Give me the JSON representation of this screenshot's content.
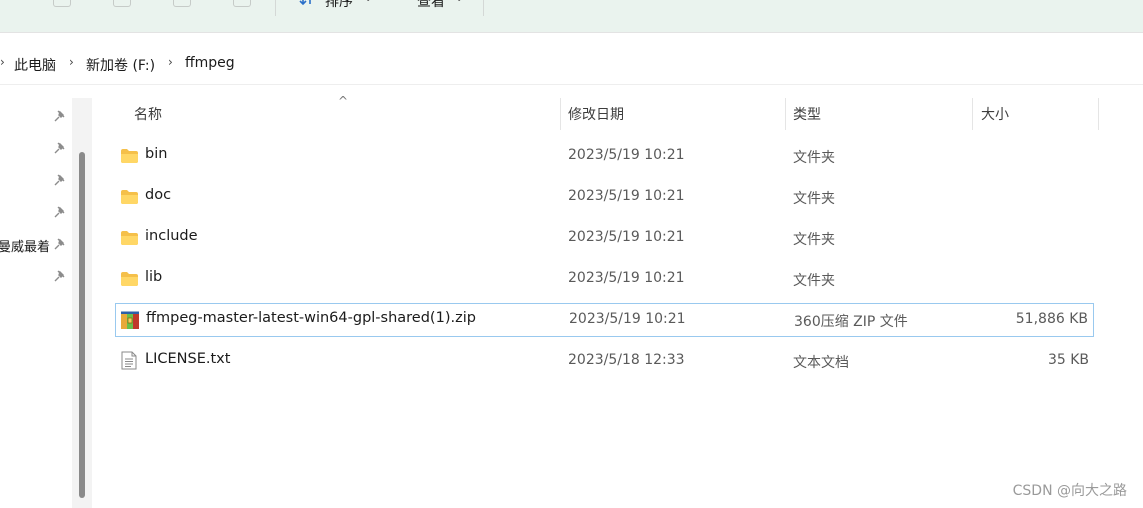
{
  "toolbar": {
    "sort_label": "排序",
    "view_label": "查看",
    "more_label": "···"
  },
  "breadcrumb": {
    "items": [
      "此电脑",
      "新加卷 (F:)",
      "ffmpeg"
    ]
  },
  "nav": {
    "partial_item": "曼威最着"
  },
  "columns": {
    "name": "名称",
    "modified": "修改日期",
    "type": "类型",
    "size": "大小"
  },
  "files": [
    {
      "name": "bin",
      "modified": "2023/5/19 10:21",
      "type": "文件夹",
      "size": "",
      "icon": "folder-icon"
    },
    {
      "name": "doc",
      "modified": "2023/5/19 10:21",
      "type": "文件夹",
      "size": "",
      "icon": "folder-icon"
    },
    {
      "name": "include",
      "modified": "2023/5/19 10:21",
      "type": "文件夹",
      "size": "",
      "icon": "folder-icon"
    },
    {
      "name": "lib",
      "modified": "2023/5/19 10:21",
      "type": "文件夹",
      "size": "",
      "icon": "folder-icon"
    },
    {
      "name": "ffmpeg-master-latest-win64-gpl-shared(1).zip",
      "modified": "2023/5/19 10:21",
      "type": "360压缩 ZIP 文件",
      "size": "51,886 KB",
      "icon": "zip-archive-icon",
      "selected": true
    },
    {
      "name": "LICENSE.txt",
      "modified": "2023/5/18 12:33",
      "type": "文本文档",
      "size": "35 KB",
      "icon": "text-file-icon"
    }
  ],
  "colors": {
    "toolbar_bg": "#eaf3ee",
    "selection_border": "#99c9ef",
    "folder_yellow": "#f5c04a"
  },
  "watermark": "CSDN @向大之路"
}
